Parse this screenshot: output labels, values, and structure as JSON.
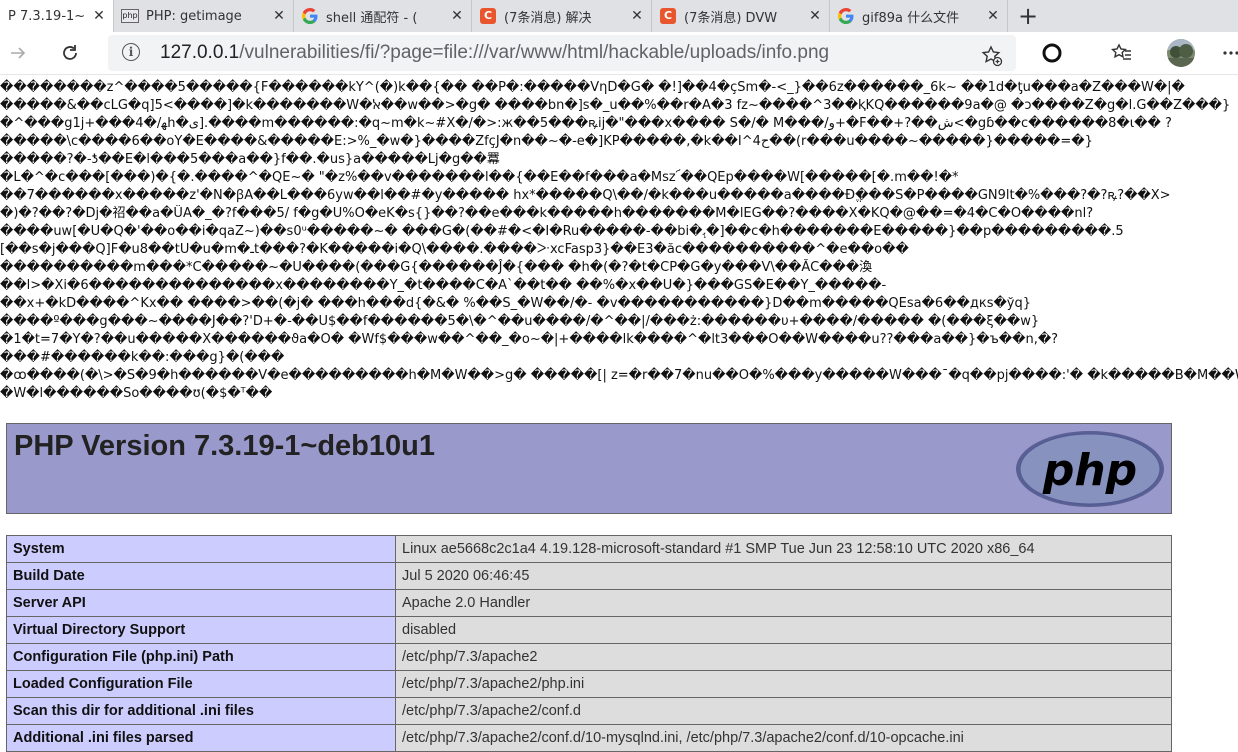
{
  "browser": {
    "tabs": [
      {
        "title": "P 7.3.19-1~d",
        "favicon": "none",
        "active": true
      },
      {
        "title": "PHP: getimage",
        "favicon": "php-icon",
        "active": false
      },
      {
        "title": "shell 通配符 - (",
        "favicon": "google-icon",
        "active": false
      },
      {
        "title": "(7条消息) 解决",
        "favicon": "csdn-icon",
        "active": false
      },
      {
        "title": "(7条消息) DVW",
        "favicon": "csdn-icon",
        "active": false
      },
      {
        "title": "gif89a 什么文件",
        "favicon": "google-icon",
        "active": false
      }
    ],
    "new_tab_label": "+",
    "close_label": "✕",
    "url": {
      "host": "127.0.0.1",
      "path": "/vulnerabilities/fi/?page=file:///var/www/html/hackable/uploads/info.png"
    }
  },
  "garbage_lines": [
    "��������z^����5�����{F������kY^(�)k��{�� ��P�:�����VηD�G� �!]��4�ҫSm�-<_}��6z������_6k~ ��1d�ƫu���a�Z���W�|�",
    "�����&��cLG�q]5<����]�k�������W�ﭏ��w��>�g� ����bn�]s�_u��%��r�A�3 fz~����^3��ⱪKQ������9a�@ �ↄ����Z�g�l.G��Z���}",
    "�^���g1j+���4�/ﻬh�ﯼ].����m������:�q~m�k~#X�/�>:ж��5���ꝶij�\"���x���� S�/� M���/ﻭ+�F��+?��ﺵ<�gɓ��c������8�ɩ�� ?",
    "�����\\c����6��oY�E����&�����E:>%_�w�}����ZfçJ�n��~�-e�]KP�����,�k��I^ﺡ4��(r���u����~�����}�����=�}",
    "�����?�-ƾ��E�l���5���a��}f��.�us}a�����Lj�g��羃",
    "�L�^�c���[���)�{�.����^�QE~� \"�z%��v�������l��{��E��f���a�Msz՜��QEp����W[�����[�.m��!�*",
    "��7������x�����z'�N�ꞵA��L���6yw��l��#�y����� hx*�����Q\\��/�k���u�����a����Ðֱ���S�P����GN9lt�%���?�?ꝶ?��X>",
    "�)�?��?�Dj�祒��a�ÜA�_�?f���5/ f�g�U%O�eK�s{}��?��e���k�����h�������M�lEG��?����X�KQ�@��=�4�C�O����nl?",
    "����uw[�U�Q�'��o��i�qaZ~)��s0ᵘ�����~� ���G�(��#�<�I�Ru�����-��bi�ﮨ�]��c�h�������E�����}��p���������.5",
    "[��s�j���Q]F�u8��tU�u�m�ـt���?�K�����i�Q\\����.����ᑁxcFasp3}��E3�ăc����������^�e��o��",
    "����������m���*C�����~�U����(���G{������Ĵ�{��� �h�(�?�t�CP�G�y���V\\��ĂC���渙",
    "��l>�Xi�6��������������x��������Y_�t����C�A`��t�� ��%�x��U�}���GS�E��Y_�����-",
    "��x+�kD����^Kx�� ����>��(�j� ���h���d{�&� %��S_�W��/�- �v�����������}D��m�����QEsa�6��дкs�ўq}",
    "����º���g���~����J��?'D+�-��U$��f������5�\\�^��u����/�^��|/���ż:������υ+����/����� �(���ξ��w}",
    "�1�t=7�Y�?��u�����X������ϑa�O� �Wf$���w��^��_�o~�|+����lk����^�lt3���O��W����u??���a��}�ъ��n,�?",
    "���#������k��:���g}�(���",
    "�ꝏ����(�\\>�S�9�h������V�e���������h�M�W��>g� �����[| z=�r��7�nu��O�%���y�����W���¯�q��pj����:'� �k�����B�M��W�#�ч;Qc}",
    "�W�l������So����ʊ(�$�ᵀ��"
  ],
  "php": {
    "version_title": "PHP Version 7.3.19-1~deb10u1",
    "logo_text": "php",
    "rows": [
      {
        "key": "System",
        "value": "Linux ae5668c2c1a4 4.19.128-microsoft-standard #1 SMP Tue Jun 23 12:58:10 UTC 2020 x86_64"
      },
      {
        "key": "Build Date",
        "value": "Jul 5 2020 06:46:45"
      },
      {
        "key": "Server API",
        "value": "Apache 2.0 Handler"
      },
      {
        "key": "Virtual Directory Support",
        "value": "disabled"
      },
      {
        "key": "Configuration File (php.ini) Path",
        "value": "/etc/php/7.3/apache2"
      },
      {
        "key": "Loaded Configuration File",
        "value": "/etc/php/7.3/apache2/php.ini"
      },
      {
        "key": "Scan this dir for additional .ini files",
        "value": "/etc/php/7.3/apache2/conf.d"
      },
      {
        "key": "Additional .ini files parsed",
        "value": "/etc/php/7.3/apache2/conf.d/10-mysqlnd.ini, /etc/php/7.3/apache2/conf.d/10-opcache.ini"
      }
    ]
  }
}
